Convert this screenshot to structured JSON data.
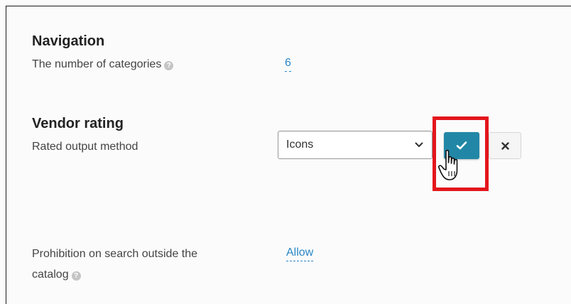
{
  "sections": {
    "navigation": {
      "title": "Navigation",
      "categories_label": "The number of categories",
      "categories_value": "6"
    },
    "vendor_rating": {
      "title": "Vendor rating",
      "output_label": "Rated output method",
      "output_value": "Icons"
    },
    "search": {
      "label_line1": "Prohibition on search outside the",
      "label_line2": "catalog",
      "value": "Allow"
    }
  },
  "icons": {
    "help": "question-circle-icon",
    "confirm": "check-icon",
    "cancel": "close-icon",
    "dropdown": "chevron-down-icon",
    "cursor": "hand-pointer-cursor-icon"
  },
  "colors": {
    "accent": "#2287a6",
    "link": "#2a86c7",
    "highlight": "#e3161c"
  }
}
